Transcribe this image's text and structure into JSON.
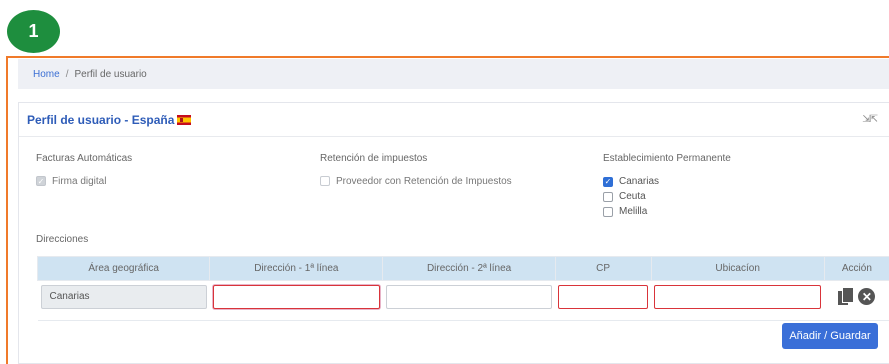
{
  "step": {
    "number": "1"
  },
  "breadcrumb": {
    "home": "Home",
    "separator": "/",
    "current": "Perfil de usuario"
  },
  "card": {
    "title": "Perfil de usuario - España"
  },
  "facturas": {
    "title": "Facturas Automáticas",
    "option": "Firma digital",
    "checked": true
  },
  "retencion": {
    "title": "Retención de impuestos",
    "option": "Proveedor con Retención de Impuestos",
    "checked": false
  },
  "establecimiento": {
    "title": "Establecimiento Permanente",
    "options": [
      {
        "label": "Canarias",
        "checked": true
      },
      {
        "label": "Ceuta",
        "checked": false
      },
      {
        "label": "Melilla",
        "checked": false
      }
    ]
  },
  "direcciones": {
    "label": "Direcciones",
    "headers": [
      "Área geográfica",
      "Dirección - 1ª línea",
      "Dirección - 2ª línea",
      "CP",
      "Ubicacíon",
      "Acción"
    ],
    "row": {
      "area": "Canarias",
      "linea1": "",
      "linea2": "",
      "cp": "",
      "ubicacion": ""
    }
  },
  "buttons": {
    "save": "Añadir / Guardar"
  },
  "colors": {
    "accent": "#3a6fd8",
    "badge": "#1e8e3e",
    "frame": "#f07a2a",
    "error": "#d9343a"
  }
}
